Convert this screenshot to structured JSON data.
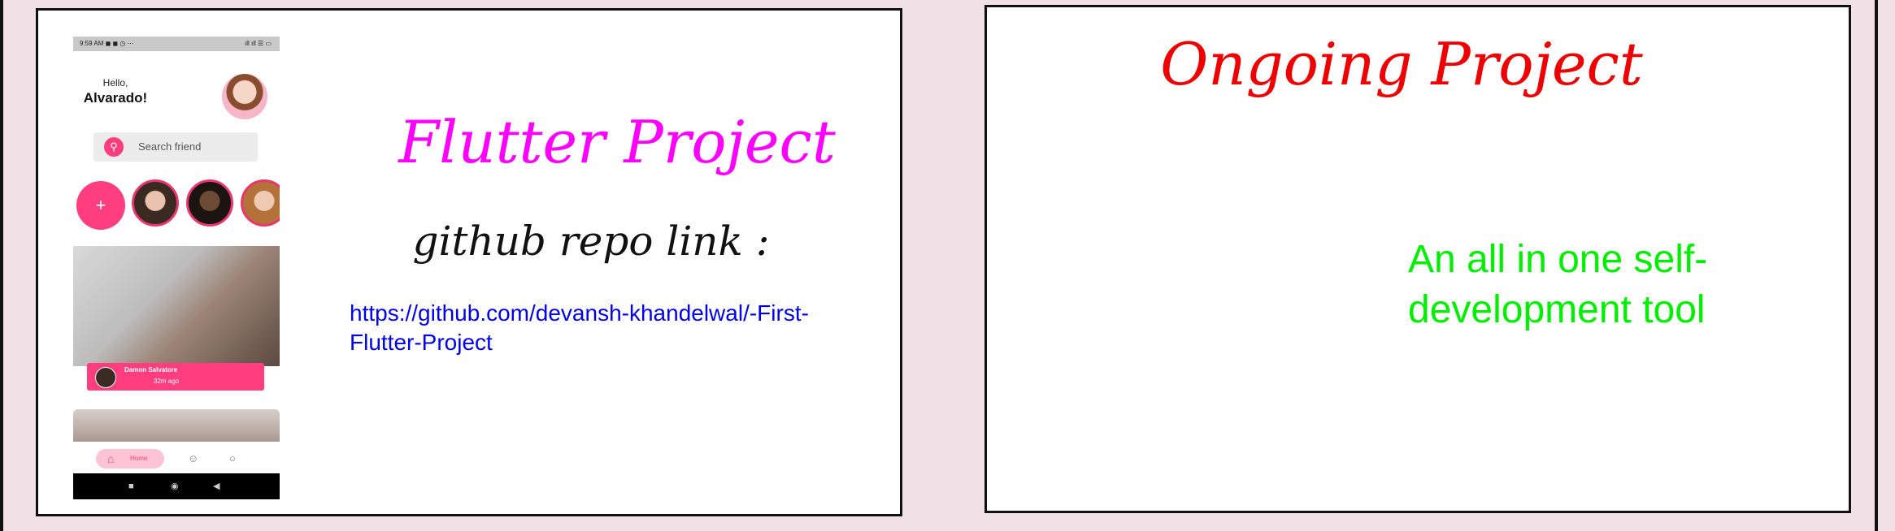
{
  "left_slide": {
    "title": "Flutter Project",
    "repo_label": "github repo link :",
    "repo_link": "https://github.com/devansh-khandelwal/-First-Flutter-Project",
    "phone": {
      "status_time": "9:59 AM",
      "status_icons": "◼ ◼ ◷ ⋯",
      "status_system": "ıll ıll ☰ ▭",
      "greeting": "Hello,",
      "user_name": "Alvarado!",
      "search_placeholder": "Search friend",
      "add_story_symbol": "+",
      "post_author": "Damon Salvatore",
      "post_time": "32m ago",
      "nav_home_label": "Home"
    }
  },
  "right_slide": {
    "title": "Ongoing Project",
    "description": "An all in one self-development tool"
  },
  "colors": {
    "accent_pink": "#ff3d7f",
    "title_magenta": "#ff00ff",
    "title_red": "#ee0000",
    "desc_green": "#00ee00",
    "link_blue": "#0000ee"
  }
}
